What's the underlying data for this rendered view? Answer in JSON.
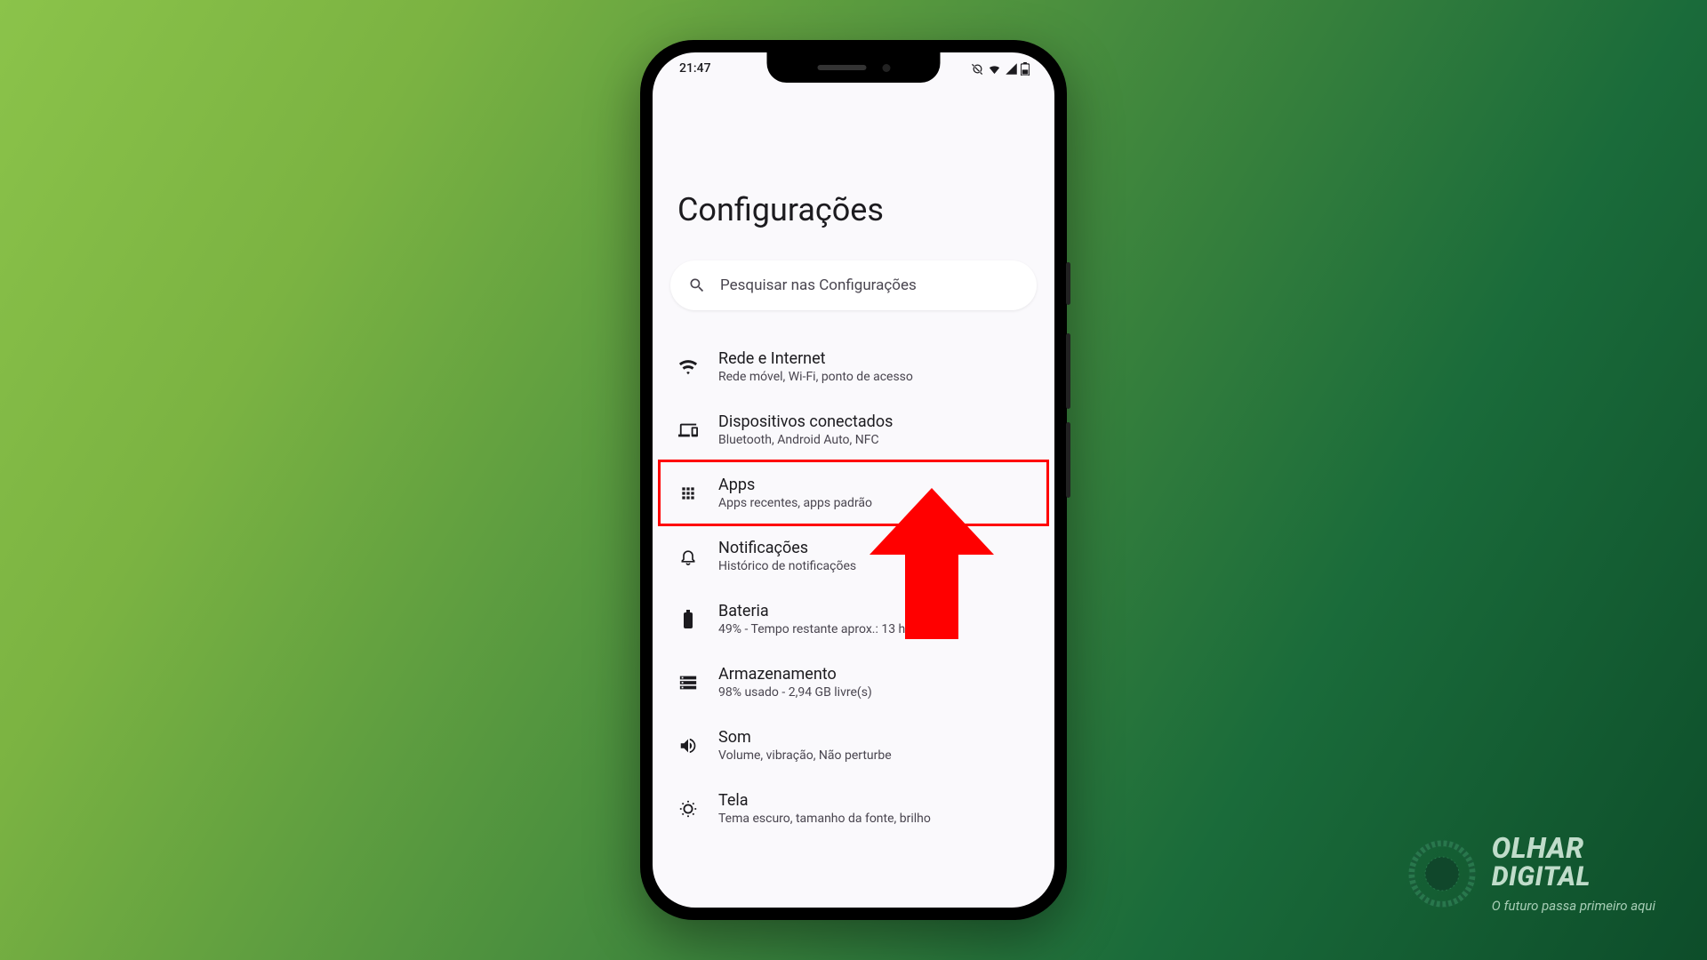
{
  "status": {
    "time": "21:47"
  },
  "page": {
    "title": "Configurações"
  },
  "search": {
    "placeholder": "Pesquisar nas Configurações"
  },
  "settings": [
    {
      "icon": "wifi",
      "title": "Rede e Internet",
      "sub": "Rede móvel, Wi-Fi, ponto de acesso",
      "highlight": false
    },
    {
      "icon": "devices",
      "title": "Dispositivos conectados",
      "sub": "Bluetooth, Android Auto, NFC",
      "highlight": false
    },
    {
      "icon": "apps",
      "title": "Apps",
      "sub": "Apps recentes, apps padrão",
      "highlight": true
    },
    {
      "icon": "bell",
      "title": "Notificações",
      "sub": "Histórico de notificações",
      "highlight": false
    },
    {
      "icon": "battery",
      "title": "Bateria",
      "sub": "49% - Tempo restante aprox.: 13 h e 28 min",
      "highlight": false
    },
    {
      "icon": "storage",
      "title": "Armazenamento",
      "sub": "98% usado - 2,94 GB livre(s)",
      "highlight": false
    },
    {
      "icon": "sound",
      "title": "Som",
      "sub": "Volume, vibração, Não perturbe",
      "highlight": false
    },
    {
      "icon": "display",
      "title": "Tela",
      "sub": "Tema escuro, tamanho da fonte, brilho",
      "highlight": false
    }
  ],
  "watermark": {
    "line1": "OLHAR",
    "line2": "DIGITAL",
    "tag": "O futuro passa primeiro aqui"
  }
}
